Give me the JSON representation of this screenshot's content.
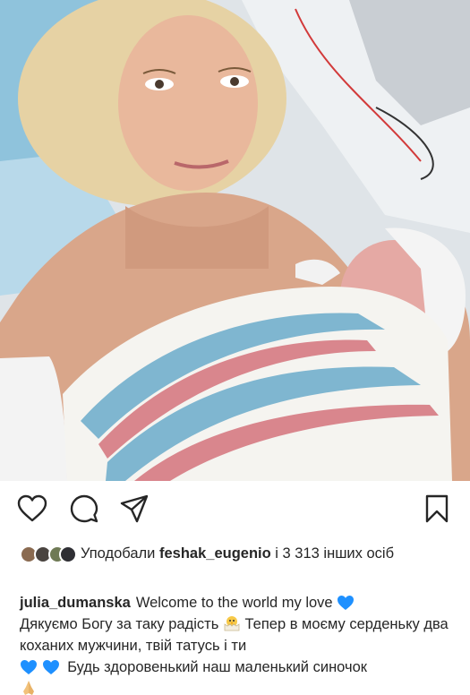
{
  "post": {
    "photo_alt": "",
    "liked_prefix": "Уподобали",
    "liked_user": "feshak_eugenio",
    "liked_suffix": "і 3 313 інших осіб",
    "caption_user": "julia_dumanska",
    "caption_lines": [
      "Welcome to the world my love",
      "Дякуємо Богу за таку радість",
      "Тепер в моєму серденьку два коханих мужчини, твій татусь і ти",
      "Будь здоровенький наш маленький синочок"
    ]
  },
  "actions": {
    "icons": [
      "heart-icon",
      "comment-icon",
      "share-icon",
      "bookmark-icon"
    ]
  },
  "emoji": {
    "blue_heart": "blue-heart-emoji",
    "chick": "hatching-chick-emoji",
    "pray": "folded-hands-emoji"
  },
  "colors": {
    "text": "#262626",
    "blue_heart": "#1e90ff"
  }
}
